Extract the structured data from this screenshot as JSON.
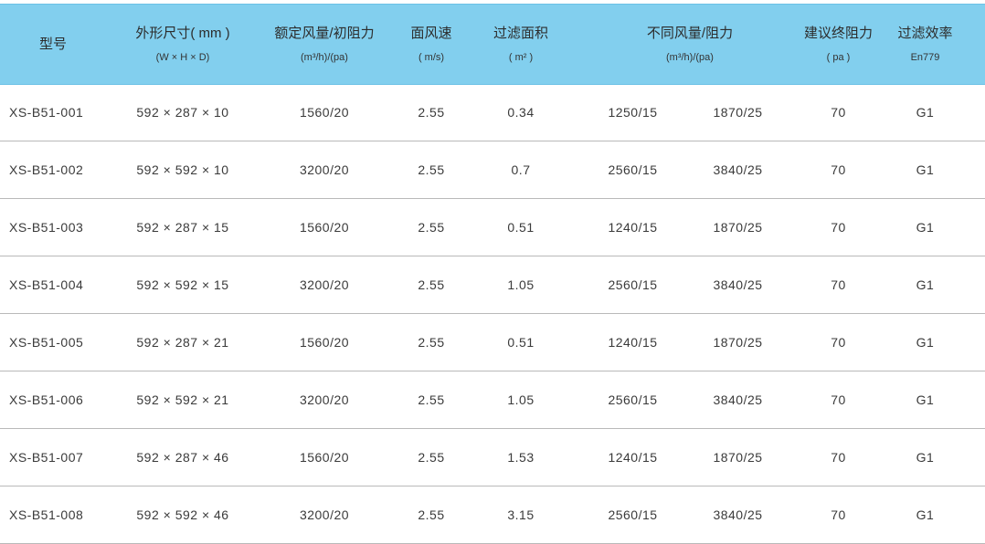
{
  "header": {
    "model": {
      "main": "型号"
    },
    "dims": {
      "main": "外形尺寸( mm )",
      "sub": "(W × H × D)"
    },
    "rated": {
      "main": "额定风量/初阻力",
      "sub": "(m³/h)/(pa)"
    },
    "velocity": {
      "main": "面风速",
      "sub": "( m/s)"
    },
    "area": {
      "main": "过滤面积",
      "sub": "( m² )"
    },
    "variable": {
      "main": "不同风量/阻力",
      "sub": "(m³/h)/(pa)"
    },
    "final_resistance": {
      "main": "建议终阻力",
      "sub": "( pa )"
    },
    "efficiency": {
      "main": "过滤效率",
      "sub": "En779"
    }
  },
  "rows": [
    {
      "model": "XS-B51-001",
      "dims": "592 × 287 × 10",
      "rated": "1560/20",
      "velocity": "2.55",
      "area": "0.34",
      "var1": "1250/15",
      "var2": "1870/25",
      "final": "70",
      "eff": "G1"
    },
    {
      "model": "XS-B51-002",
      "dims": "592 × 592 × 10",
      "rated": "3200/20",
      "velocity": "2.55",
      "area": "0.7",
      "var1": "2560/15",
      "var2": "3840/25",
      "final": "70",
      "eff": "G1"
    },
    {
      "model": "XS-B51-003",
      "dims": "592 × 287 × 15",
      "rated": "1560/20",
      "velocity": "2.55",
      "area": "0.51",
      "var1": "1240/15",
      "var2": "1870/25",
      "final": "70",
      "eff": "G1"
    },
    {
      "model": "XS-B51-004",
      "dims": "592 × 592 × 15",
      "rated": "3200/20",
      "velocity": "2.55",
      "area": "1.05",
      "var1": "2560/15",
      "var2": "3840/25",
      "final": "70",
      "eff": "G1"
    },
    {
      "model": "XS-B51-005",
      "dims": "592 × 287 × 21",
      "rated": "1560/20",
      "velocity": "2.55",
      "area": "0.51",
      "var1": "1240/15",
      "var2": "1870/25",
      "final": "70",
      "eff": "G1"
    },
    {
      "model": "XS-B51-006",
      "dims": "592 × 592 × 21",
      "rated": "3200/20",
      "velocity": "2.55",
      "area": "1.05",
      "var1": "2560/15",
      "var2": "3840/25",
      "final": "70",
      "eff": "G1"
    },
    {
      "model": "XS-B51-007",
      "dims": "592 × 287 × 46",
      "rated": "1560/20",
      "velocity": "2.55",
      "area": "1.53",
      "var1": "1240/15",
      "var2": "1870/25",
      "final": "70",
      "eff": "G1"
    },
    {
      "model": "XS-B51-008",
      "dims": "592 × 592 × 46",
      "rated": "3200/20",
      "velocity": "2.55",
      "area": "3.15",
      "var1": "2560/15",
      "var2": "3840/25",
      "final": "70",
      "eff": "G1"
    }
  ],
  "colors": {
    "header_bg": "#82cfee",
    "row_divider": "#b9b9b9",
    "text": "#3a3a3a"
  }
}
